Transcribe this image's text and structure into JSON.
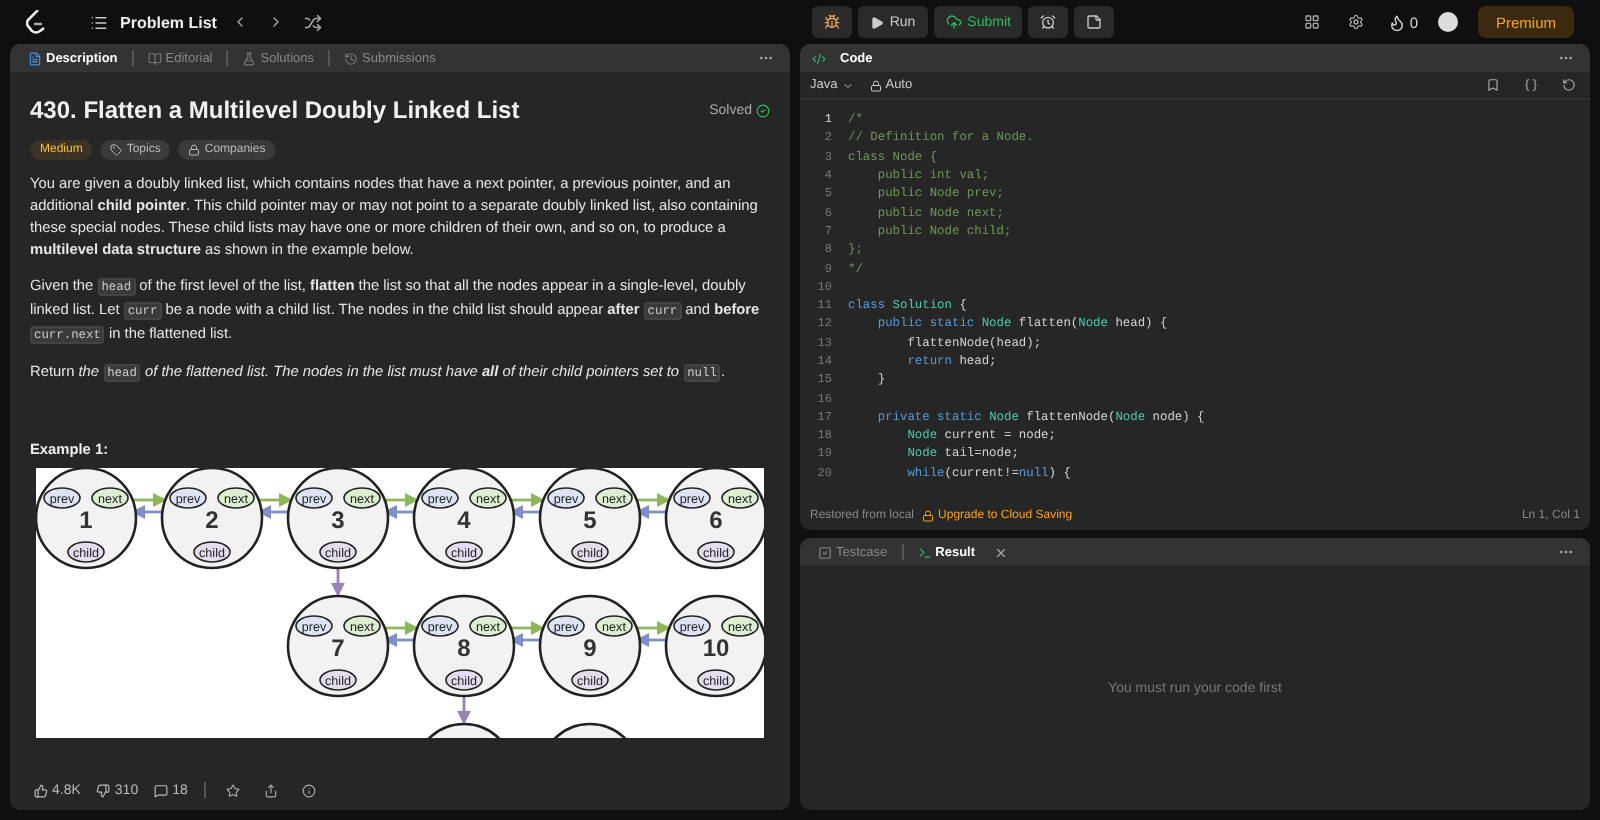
{
  "top_bar": {
    "nav_title": "Problem List",
    "run_label": "Run",
    "submit_label": "Submit",
    "streak": "0",
    "premium_label": "Premium"
  },
  "description_panel": {
    "tabs": [
      {
        "label": "Description",
        "selected": true
      },
      {
        "label": "Editorial",
        "selected": false
      },
      {
        "label": "Solutions",
        "selected": false
      },
      {
        "label": "Submissions",
        "selected": false
      }
    ],
    "title": "430. Flatten a Multilevel Doubly Linked List",
    "status": "Solved",
    "tags": [
      {
        "label": "Medium",
        "kind": "difficulty"
      },
      {
        "label": "Topics",
        "kind": "topics"
      },
      {
        "label": "Companies",
        "kind": "companies"
      }
    ],
    "paragraphs": [
      {
        "italic": false,
        "segments": [
          {
            "kind": "text",
            "text": "You are given a doubly linked list, which contains nodes that have a next pointer, a previous pointer, and an additional **child pointer**. This child pointer may or may not point to a separate doubly linked list, also containing these special nodes. These child lists may have one or more children of their own, and so on, to produce a **multilevel data structure** as shown in the example below."
          }
        ]
      },
      {
        "italic": false,
        "segments": [
          {
            "kind": "text",
            "text": "Given the "
          },
          {
            "kind": "code",
            "text": "head"
          },
          {
            "kind": "text",
            "text": " of the first level of the list, **flatten** the list so that all the nodes appear in a single-level, doubly linked list. Let "
          },
          {
            "kind": "code",
            "text": "curr"
          },
          {
            "kind": "text",
            "text": " be a node with a child list. The nodes in the child list should appear **after** "
          },
          {
            "kind": "code",
            "text": "curr"
          },
          {
            "kind": "text",
            "text": " and **before** "
          },
          {
            "kind": "code",
            "text": "curr.next"
          },
          {
            "kind": "text",
            "text": " in the flattened list."
          }
        ]
      },
      {
        "italic": true,
        "segments": [
          {
            "kind": "plain",
            "text": "Return "
          },
          {
            "kind": "text",
            "text": "the "
          },
          {
            "kind": "code",
            "text": "head"
          },
          {
            "kind": "text",
            "text": " of the flattened list. The nodes in the list must have **all** of their child pointers set to "
          },
          {
            "kind": "code",
            "text": "null"
          },
          {
            "kind": "plain",
            "text": "."
          }
        ]
      }
    ],
    "example": {
      "heading": "Example 1:",
      "nodes": [
        {
          "value": "1",
          "pointers": [
            "prev",
            "next",
            "child"
          ]
        },
        {
          "value": "2",
          "pointers": [
            "prev",
            "next",
            "child"
          ]
        },
        {
          "value": "3",
          "pointers": [
            "prev",
            "next",
            "child"
          ],
          "children": [
            {
              "value": "7",
              "pointers": [
                "prev",
                "next",
                "child"
              ]
            },
            {
              "value": "8",
              "pointers": [
                "prev",
                "next",
                "child"
              ],
              "children": [
                {
                  "kind": "node"
                },
                {
                  "kind": "node"
                }
              ]
            },
            {
              "value": "9",
              "pointers": [
                "prev",
                "next",
                "child"
              ]
            },
            {
              "value": "10",
              "pointers": [
                "prev",
                "next",
                "child"
              ]
            }
          ]
        },
        {
          "value": "4",
          "pointers": [
            "prev",
            "next",
            "child"
          ]
        },
        {
          "value": "5",
          "pointers": [
            "prev",
            "next",
            "child"
          ]
        },
        {
          "value": "6",
          "pointers": [
            "prev",
            "next",
            "child"
          ]
        }
      ]
    },
    "footer": {
      "likes": "4.8K",
      "dislikes": "310",
      "comments": "18"
    }
  },
  "code_panel": {
    "title": "Code",
    "language": "Java",
    "mode": "Auto",
    "lines": [
      {
        "number": "1",
        "tokens": [
          {
            "text": "/*",
            "kind": "comment"
          }
        ]
      },
      {
        "number": "2",
        "tokens": [
          {
            "text": "// Definition for a Node.",
            "kind": "comment"
          }
        ]
      },
      {
        "number": "3",
        "tokens": [
          {
            "text": "class Node {",
            "kind": "comment"
          }
        ]
      },
      {
        "number": "4",
        "tokens": [
          {
            "text": "    public int val;",
            "kind": "comment"
          }
        ]
      },
      {
        "number": "5",
        "tokens": [
          {
            "text": "    public Node prev;",
            "kind": "comment"
          }
        ]
      },
      {
        "number": "6",
        "tokens": [
          {
            "text": "    public Node next;",
            "kind": "comment"
          }
        ]
      },
      {
        "number": "7",
        "tokens": [
          {
            "text": "    public Node child;",
            "kind": "comment"
          }
        ]
      },
      {
        "number": "8",
        "tokens": [
          {
            "text": "};",
            "kind": "comment"
          }
        ]
      },
      {
        "number": "9",
        "tokens": [
          {
            "text": "*/",
            "kind": "comment"
          }
        ]
      },
      {
        "number": "10"
      },
      {
        "number": "11",
        "tokens": [
          {
            "text": "class ",
            "kind": "keyword"
          },
          {
            "text": "Solution",
            "kind": "type"
          },
          {
            "text": " {",
            "kind": "plain"
          }
        ]
      },
      {
        "number": "12",
        "tokens": [
          {
            "text": "    public static ",
            "kind": "keyword"
          },
          {
            "text": "Node",
            "kind": "type"
          },
          {
            "text": " flatten(",
            "kind": "plain"
          },
          {
            "text": "Node",
            "kind": "type"
          },
          {
            "text": " head) {",
            "kind": "plain"
          }
        ]
      },
      {
        "number": "13",
        "tokens": [
          {
            "text": "        flattenNode(head);",
            "kind": "plain"
          }
        ]
      },
      {
        "number": "14",
        "tokens": [
          {
            "text": "        return",
            "kind": "keyword"
          },
          {
            "text": " head;",
            "kind": "plain"
          }
        ]
      },
      {
        "number": "15",
        "tokens": [
          {
            "text": "    }",
            "kind": "plain"
          }
        ]
      },
      {
        "number": "16"
      },
      {
        "number": "17",
        "tokens": [
          {
            "text": "    private static ",
            "kind": "keyword"
          },
          {
            "text": "Node",
            "kind": "type"
          },
          {
            "text": " flattenNode(",
            "kind": "plain"
          },
          {
            "text": "Node",
            "kind": "type"
          },
          {
            "text": " node) {",
            "kind": "plain"
          }
        ]
      },
      {
        "number": "18",
        "tokens": [
          {
            "text": "        Node",
            "kind": "type"
          },
          {
            "text": " current = node;",
            "kind": "plain"
          }
        ]
      },
      {
        "number": "19",
        "tokens": [
          {
            "text": "        Node",
            "kind": "type"
          },
          {
            "text": " tail=node;",
            "kind": "plain"
          }
        ]
      },
      {
        "number": "20",
        "tokens": [
          {
            "text": "        while",
            "kind": "keyword"
          },
          {
            "text": "(current!=",
            "kind": "plain"
          },
          {
            "text": "null",
            "kind": "keyword"
          },
          {
            "text": ") {",
            "kind": "plain"
          }
        ]
      }
    ],
    "status_left": "Restored from local",
    "upgrade_link": "Upgrade to Cloud Saving",
    "cursor": "Ln 1, Col 1"
  },
  "result_panel": {
    "tabs": [
      {
        "label": "Testcase",
        "selected": false
      },
      {
        "label": "Result",
        "selected": true
      }
    ],
    "message": "You must run your code first"
  }
}
